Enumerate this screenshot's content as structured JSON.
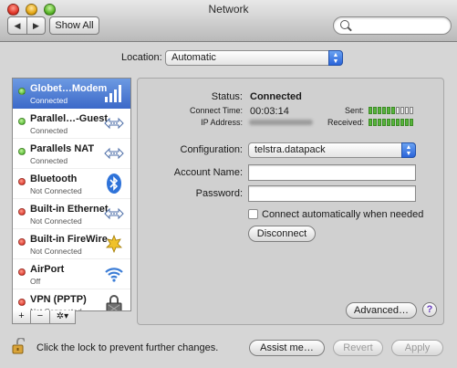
{
  "window": {
    "title": "Network"
  },
  "toolbar": {
    "back_label": "◀",
    "forward_label": "▶",
    "show_all_label": "Show All",
    "search_placeholder": ""
  },
  "location": {
    "label": "Location:",
    "value": "Automatic"
  },
  "services": [
    {
      "name": "Globet…Modem",
      "status": "Connected",
      "status_color": "green",
      "icon": "signal-bars-icon"
    },
    {
      "name": "Parallel…-Guest",
      "status": "Connected",
      "status_color": "green",
      "icon": "ethernet-arrows-icon"
    },
    {
      "name": "Parallels NAT",
      "status": "Connected",
      "status_color": "green",
      "icon": "ethernet-arrows-icon"
    },
    {
      "name": "Bluetooth",
      "status": "Not Connected",
      "status_color": "red",
      "icon": "bluetooth-icon"
    },
    {
      "name": "Built-in Ethernet",
      "status": "Not Connected",
      "status_color": "red",
      "icon": "ethernet-arrows-icon"
    },
    {
      "name": "Built-in FireWire",
      "status": "Not Connected",
      "status_color": "red",
      "icon": "firewire-icon"
    },
    {
      "name": "AirPort",
      "status": "Off",
      "status_color": "red",
      "icon": "wifi-icon"
    },
    {
      "name": "VPN (PPTP)",
      "status": "Not Connected",
      "status_color": "red",
      "icon": "vpn-lock-icon"
    }
  ],
  "list_buttons": {
    "add": "+",
    "remove": "−",
    "gear": "✲▾"
  },
  "detail": {
    "status_label": "Status:",
    "status_value": "Connected",
    "connect_time_label": "Connect Time:",
    "connect_time_value": "00:03:14",
    "ip_label": "IP Address:",
    "sent_label": "Sent:",
    "sent_level": 0.6,
    "received_label": "Received:",
    "received_level": 1.0,
    "configuration_label": "Configuration:",
    "configuration_value": "telstra.datapack",
    "account_label": "Account Name:",
    "account_value": "",
    "password_label": "Password:",
    "password_value": "",
    "auto_connect_label": "Connect automatically when needed",
    "auto_connect_checked": false,
    "disconnect_label": "Disconnect",
    "advanced_label": "Advanced…",
    "help_label": "?"
  },
  "footer": {
    "lock_text": "Click the lock to prevent further changes.",
    "assist_label": "Assist me…",
    "revert_label": "Revert",
    "apply_label": "Apply"
  },
  "colors": {
    "selection": "#3d6ac9",
    "connected": "#38a917",
    "disconnected": "#d31b10",
    "meter": "#57b53c"
  }
}
